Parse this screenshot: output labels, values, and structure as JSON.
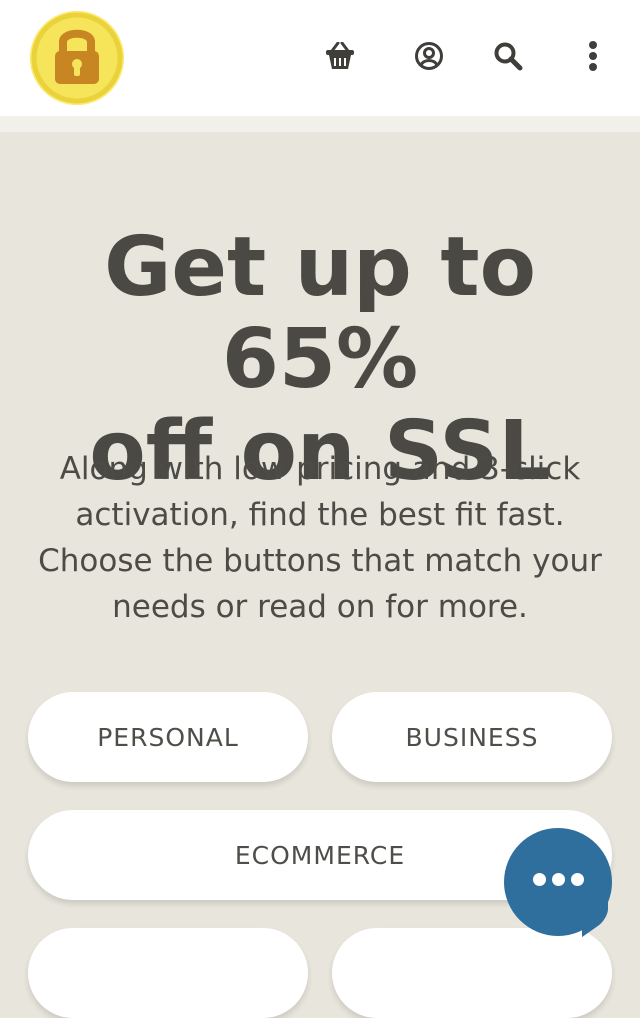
{
  "header": {
    "logo": "padlock-badge-logo",
    "icons": [
      "basket-icon",
      "account-icon",
      "search-icon",
      "more-vertical-icon"
    ]
  },
  "hero": {
    "title_line_1": "Get up to 65%",
    "title_line_2": "off on SSL",
    "description_line_1": "Along with low pricing and 3-click",
    "description_line_2": "activation, find the best fit fast.",
    "description_line_3": "Choose the buttons that match your",
    "description_line_4": "needs or read on for more."
  },
  "filters": {
    "personal": "PERSONAL",
    "business": "BUSINESS",
    "ecommerce": "ECOMMERCE"
  },
  "chat": {
    "icon": "chat-dots-icon"
  },
  "colors": {
    "page_background": "#e8e6dc",
    "header_background": "#ffffff",
    "logo_yellow": "#f4dd4d",
    "lock_brown": "#c78622",
    "chat_blue": "#2f6f9e",
    "text": "#4a4944"
  }
}
